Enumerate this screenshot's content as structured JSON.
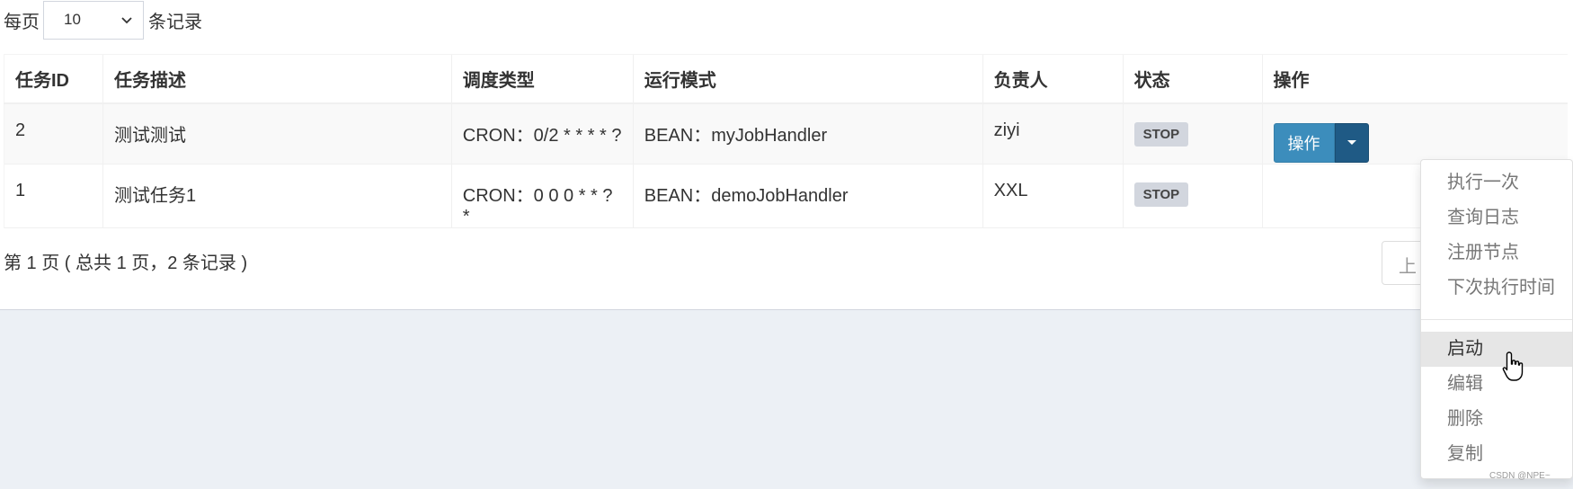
{
  "page_size": {
    "prefix": "每页",
    "value": "10",
    "suffix": "条记录"
  },
  "table": {
    "headers": [
      "任务ID",
      "任务描述",
      "调度类型",
      "运行模式",
      "负责人",
      "状态",
      "操作"
    ],
    "rows": [
      {
        "id": "2",
        "desc": "测试测试",
        "schedule": "CRON：0/2 * * * * ?",
        "mode": "BEAN：myJobHandler",
        "owner": "ziyi",
        "status": "STOP",
        "action": "操作"
      },
      {
        "id": "1",
        "desc": "测试任务1",
        "schedule": "CRON：0 0 0 * * ? *",
        "mode": "BEAN：demoJobHandler",
        "owner": "XXL",
        "status": "STOP"
      }
    ]
  },
  "pager": {
    "info": "第 1 页 ( 总共 1 页，2 条记录 )",
    "prev_label": "上"
  },
  "dropdown": {
    "group1": [
      "执行一次",
      "查询日志",
      "注册节点",
      "下次执行时间"
    ],
    "group2": [
      "启动",
      "编辑",
      "删除",
      "复制"
    ]
  },
  "watermark": "CSDN @NPE~",
  "colors": {
    "primary": "#3c8dbc",
    "caret": "#1f5a85",
    "badge": "#d2d6de",
    "background": "#ecf0f5"
  }
}
